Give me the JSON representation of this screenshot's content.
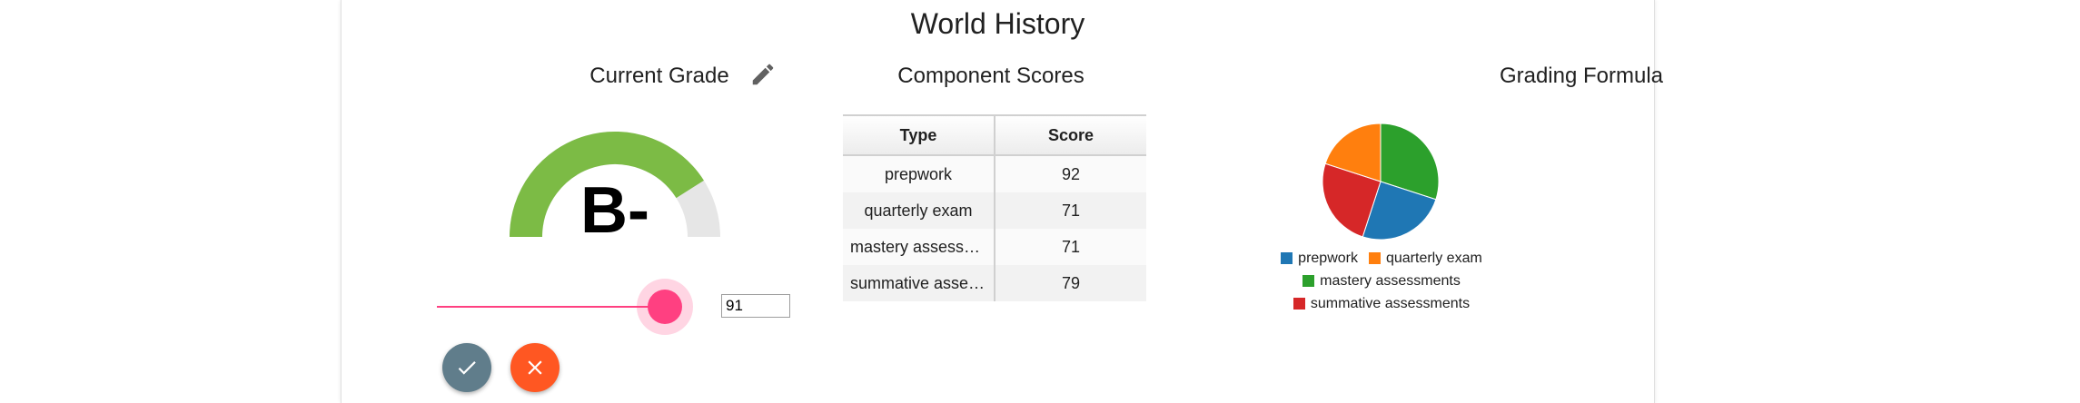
{
  "page": {
    "title": "World History"
  },
  "current_grade": {
    "title": "Current Grade",
    "letter": "B-",
    "gauge_value": 0.82,
    "gauge_fill_color": "#7cbb45",
    "gauge_bg_color": "#e6e6e6",
    "edit_icon": "pencil-icon",
    "slider": {
      "value": "91",
      "min": 0,
      "max": 100,
      "color": "#ff4081"
    },
    "confirm_icon": "check-icon",
    "cancel_icon": "close-icon",
    "confirm_color": "#607d8b",
    "cancel_color": "#ff5722"
  },
  "component_scores": {
    "title": "Component Scores",
    "headers": [
      "Type",
      "Score"
    ],
    "rows": [
      {
        "type": "prepwork",
        "score": "92"
      },
      {
        "type": "quarterly exam",
        "score": "71"
      },
      {
        "type": "mastery assessments",
        "score": "71"
      },
      {
        "type": "summative assessments",
        "score": "79"
      }
    ]
  },
  "grading_formula": {
    "title": "Grading Formula",
    "chart_data": {
      "type": "pie",
      "title": "Grading Formula",
      "slices": [
        {
          "label": "mastery assessments",
          "value": 30,
          "color": "#2ca02c"
        },
        {
          "label": "prepwork",
          "value": 25,
          "color": "#1f77b4"
        },
        {
          "label": "summative assessments",
          "value": 25,
          "color": "#d62728"
        },
        {
          "label": "quarterly exam",
          "value": 20,
          "color": "#ff7f0e"
        }
      ],
      "legend": [
        {
          "label": "prepwork",
          "color": "#1f77b4"
        },
        {
          "label": "quarterly exam",
          "color": "#ff7f0e"
        },
        {
          "label": "mastery assessments",
          "color": "#2ca02c"
        },
        {
          "label": "summative assessments",
          "color": "#d62728"
        }
      ],
      "legend_placement": "bottom"
    }
  }
}
